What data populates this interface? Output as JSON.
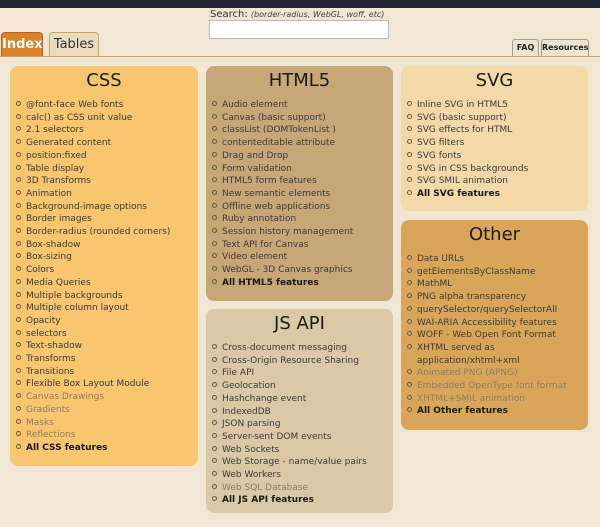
{
  "search": {
    "label": "Search:",
    "hint": "(border-radius, WebGL, woff, etc)",
    "value": ""
  },
  "tabs": {
    "index": "Index",
    "tables": "Tables",
    "faq": "FAQ",
    "resources": "Resources"
  },
  "colors": {
    "css_card": "#f7c66f",
    "html5_card": "#c7a776",
    "jsapi_card": "#dac8a6",
    "svg_card": "#f3d8a8",
    "other_card": "#d9a659",
    "active_tab": "#d9822b"
  },
  "cards": {
    "css": {
      "title": "CSS",
      "items": [
        "@font-face Web fonts",
        "calc() as CSS unit value",
        "2.1 selectors",
        "Generated content",
        "position:fixed",
        "Table display",
        "3D Transforms",
        "Animation",
        "Background-image options",
        "Border images",
        "Border-radius (rounded corners)",
        "Box-shadow",
        "Box-sizing",
        "Colors",
        "Media Queries",
        "Multiple backgrounds",
        "Multiple column layout",
        "Opacity",
        "selectors",
        "Text-shadow",
        "Transforms",
        "Transitions",
        "Flexible Box Layout Module",
        "Canvas Drawings",
        "Gradients",
        "Masks",
        "Reflections",
        "All CSS features"
      ]
    },
    "html5": {
      "title": "HTML5",
      "items": [
        "Audio element",
        "Canvas (basic support)",
        "classList (DOMTokenList )",
        "contenteditable attribute",
        "Drag and Drop",
        "Form validation",
        "HTML5 form features",
        "New semantic elements",
        "Offline web applications",
        "Ruby annotation",
        "Session history management",
        "Text API for Canvas",
        "Video element",
        "WebGL - 3D Canvas graphics",
        "All HTML5 features"
      ]
    },
    "jsapi": {
      "title": "JS API",
      "items": [
        "Cross-document messaging",
        "Cross-Origin Resource Sharing",
        "File API",
        "Geolocation",
        "Hashchange event",
        "IndexedDB",
        "JSON parsing",
        "Server-sent DOM events",
        "Web Sockets",
        "Web Storage - name/value pairs",
        "Web Workers",
        "Web SQL Database",
        "All JS API features"
      ]
    },
    "svg": {
      "title": "SVG",
      "items": [
        "Inline SVG in HTML5",
        "SVG (basic support)",
        "SVG effects for HTML",
        "SVG filters",
        "SVG fonts",
        "SVG in CSS backgrounds",
        "SVG SMIL animation",
        "All SVG features"
      ]
    },
    "other": {
      "title": "Other",
      "items": [
        "Data URLs",
        "getElementsByClassName",
        "MathML",
        "PNG alpha transparency",
        "querySelector/querySelectorAll",
        "WAI-ARIA Accessibility features",
        "WOFF - Web Open Font Format",
        "XHTML served as",
        "application/xhtml+xml",
        "Animated PNG (APNG)",
        "Embedded OpenType font format",
        "XHTML+SMIL animation",
        "All Other features"
      ]
    }
  }
}
